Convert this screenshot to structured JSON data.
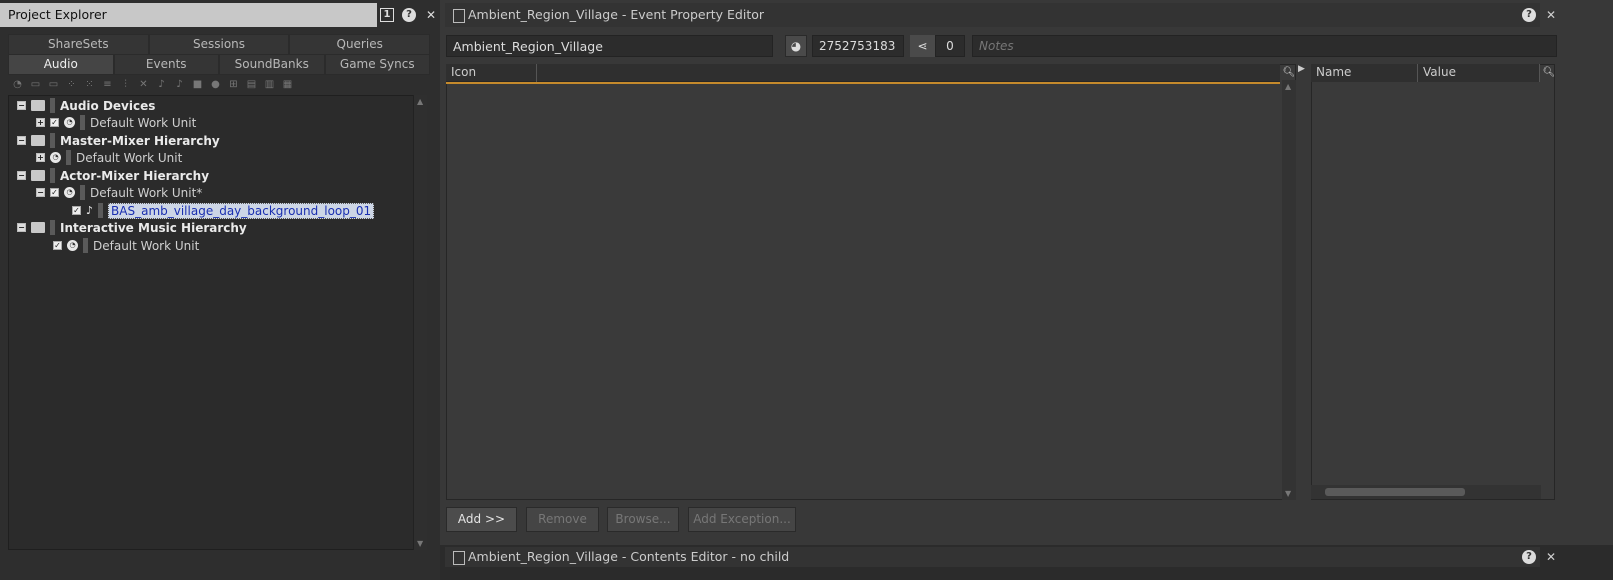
{
  "project_explorer": {
    "title": "Project Explorer",
    "tabs_row1": [
      "ShareSets",
      "Sessions",
      "Queries"
    ],
    "tabs_row2": [
      "Audio",
      "Events",
      "SoundBanks",
      "Game Syncs"
    ],
    "active_tab": "Audio",
    "tree": [
      {
        "label": "Audio Devices",
        "bold": true
      },
      {
        "label": "Default Work Unit"
      },
      {
        "label": "Master-Mixer Hierarchy",
        "bold": true
      },
      {
        "label": "Default Work Unit"
      },
      {
        "label": "Actor-Mixer Hierarchy",
        "bold": true
      },
      {
        "label": "Default Work Unit*"
      },
      {
        "label": "BAS_amb_village_day_background_loop_01",
        "selected": true
      },
      {
        "label": "Interactive Music Hierarchy",
        "bold": true
      },
      {
        "label": "Default Work Unit"
      }
    ]
  },
  "event_editor": {
    "title": "Ambient_Region_Village - Event Property Editor",
    "name": "Ambient_Region_Village",
    "id": "2752753183",
    "share_count": "0",
    "notes_placeholder": "Notes",
    "actions_column": "Icon",
    "property_columns": [
      "Name",
      "Value"
    ],
    "buttons": [
      "Add >>",
      "Remove",
      "Browse...",
      "Add Exception..."
    ]
  },
  "contents_editor": {
    "title": "Ambient_Region_Village - Contents Editor - no child"
  },
  "colors": {
    "accent_orange": "#c58a2c",
    "selection_text": "#1a2fb0"
  }
}
